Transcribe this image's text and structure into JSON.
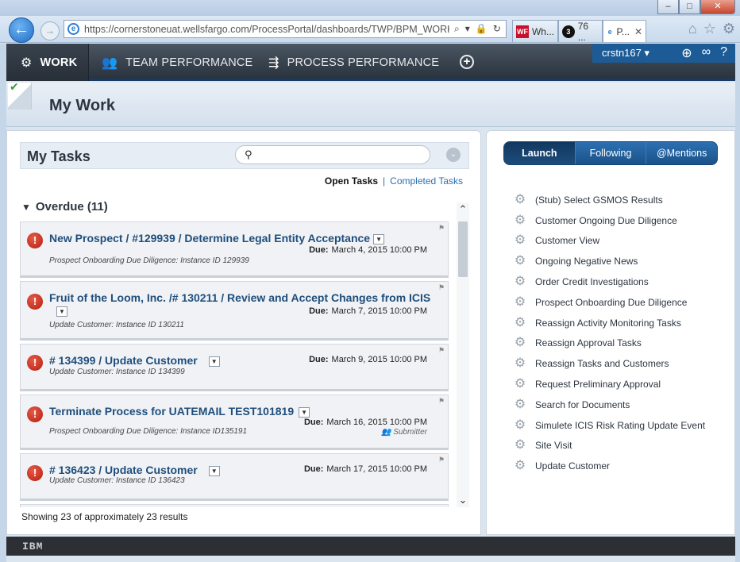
{
  "browser": {
    "url": "https://cornerstoneuat.wellsfargo.com/ProcessPortal/dashboards/TWP/BPM_WORK?tw...",
    "tabs": [
      {
        "label": "Wh..."
      },
      {
        "label": "76 ..."
      },
      {
        "label": "P..."
      }
    ]
  },
  "nav": {
    "work": "WORK",
    "team_performance": "TEAM PERFORMANCE",
    "process_performance": "PROCESS PERFORMANCE",
    "user": "crstn167 ▾"
  },
  "page": {
    "title": "My Work"
  },
  "tasks": {
    "title": "My Tasks",
    "filter_open": "Open Tasks",
    "filter_separator": "|",
    "filter_completed": "Completed Tasks",
    "group_label": "Overdue (11)",
    "items": [
      {
        "title": "New Prospect / #129939 / Determine Legal Entity Acceptance",
        "subtitle": "Prospect Onboarding Due Diligence: Instance ID 129939",
        "due_label": "Due:",
        "due": "March 4, 2015 10:00 PM"
      },
      {
        "title": "Fruit of the Loom, Inc. /# 130211 / Review and Accept Changes from ICIS",
        "subtitle": "Update Customer: Instance ID 130211",
        "due_label": "Due:",
        "due": "March 7, 2015 10:00 PM"
      },
      {
        "title": "# 134399 / Update Customer",
        "subtitle": "Update Customer: Instance ID 134399",
        "due_label": "Due:",
        "due": "March 9, 2015 10:00 PM"
      },
      {
        "title": "Terminate Process for UATEMAIL TEST101819",
        "subtitle": "Prospect Onboarding Due Diligence: Instance ID135191",
        "due_label": "Due:",
        "due": "March 16, 2015 10:00 PM",
        "extra": "Submitter"
      },
      {
        "title": "# 136423 / Update Customer",
        "subtitle": "Update Customer: Instance ID 136423",
        "due_label": "Due:",
        "due": "March 17, 2015 10:00 PM"
      }
    ],
    "showing": "Showing 23 of approximately 23 results"
  },
  "launch": {
    "tabs": [
      "Launch",
      "Following",
      "@Mentions"
    ],
    "items": [
      "(Stub) Select GSMOS Results",
      "Customer Ongoing Due Diligence",
      "Customer View",
      "Ongoing Negative News",
      "Order Credit Investigations",
      "Prospect Onboarding Due Diligence",
      "Reassign Activity Monitoring Tasks",
      "Reassign Approval Tasks",
      "Reassign Tasks and Customers",
      "Request Preliminary Approval",
      "Search for Documents",
      "Simulete ICIS Risk Rating Update Event",
      "Site Visit",
      "Update Customer"
    ]
  },
  "footer": {
    "brand": "IBM"
  },
  "colors": {
    "accent": "#1d5b96",
    "link": "#1f4e7c",
    "alert": "#c0281a",
    "nav_dark": "#2a333d"
  }
}
